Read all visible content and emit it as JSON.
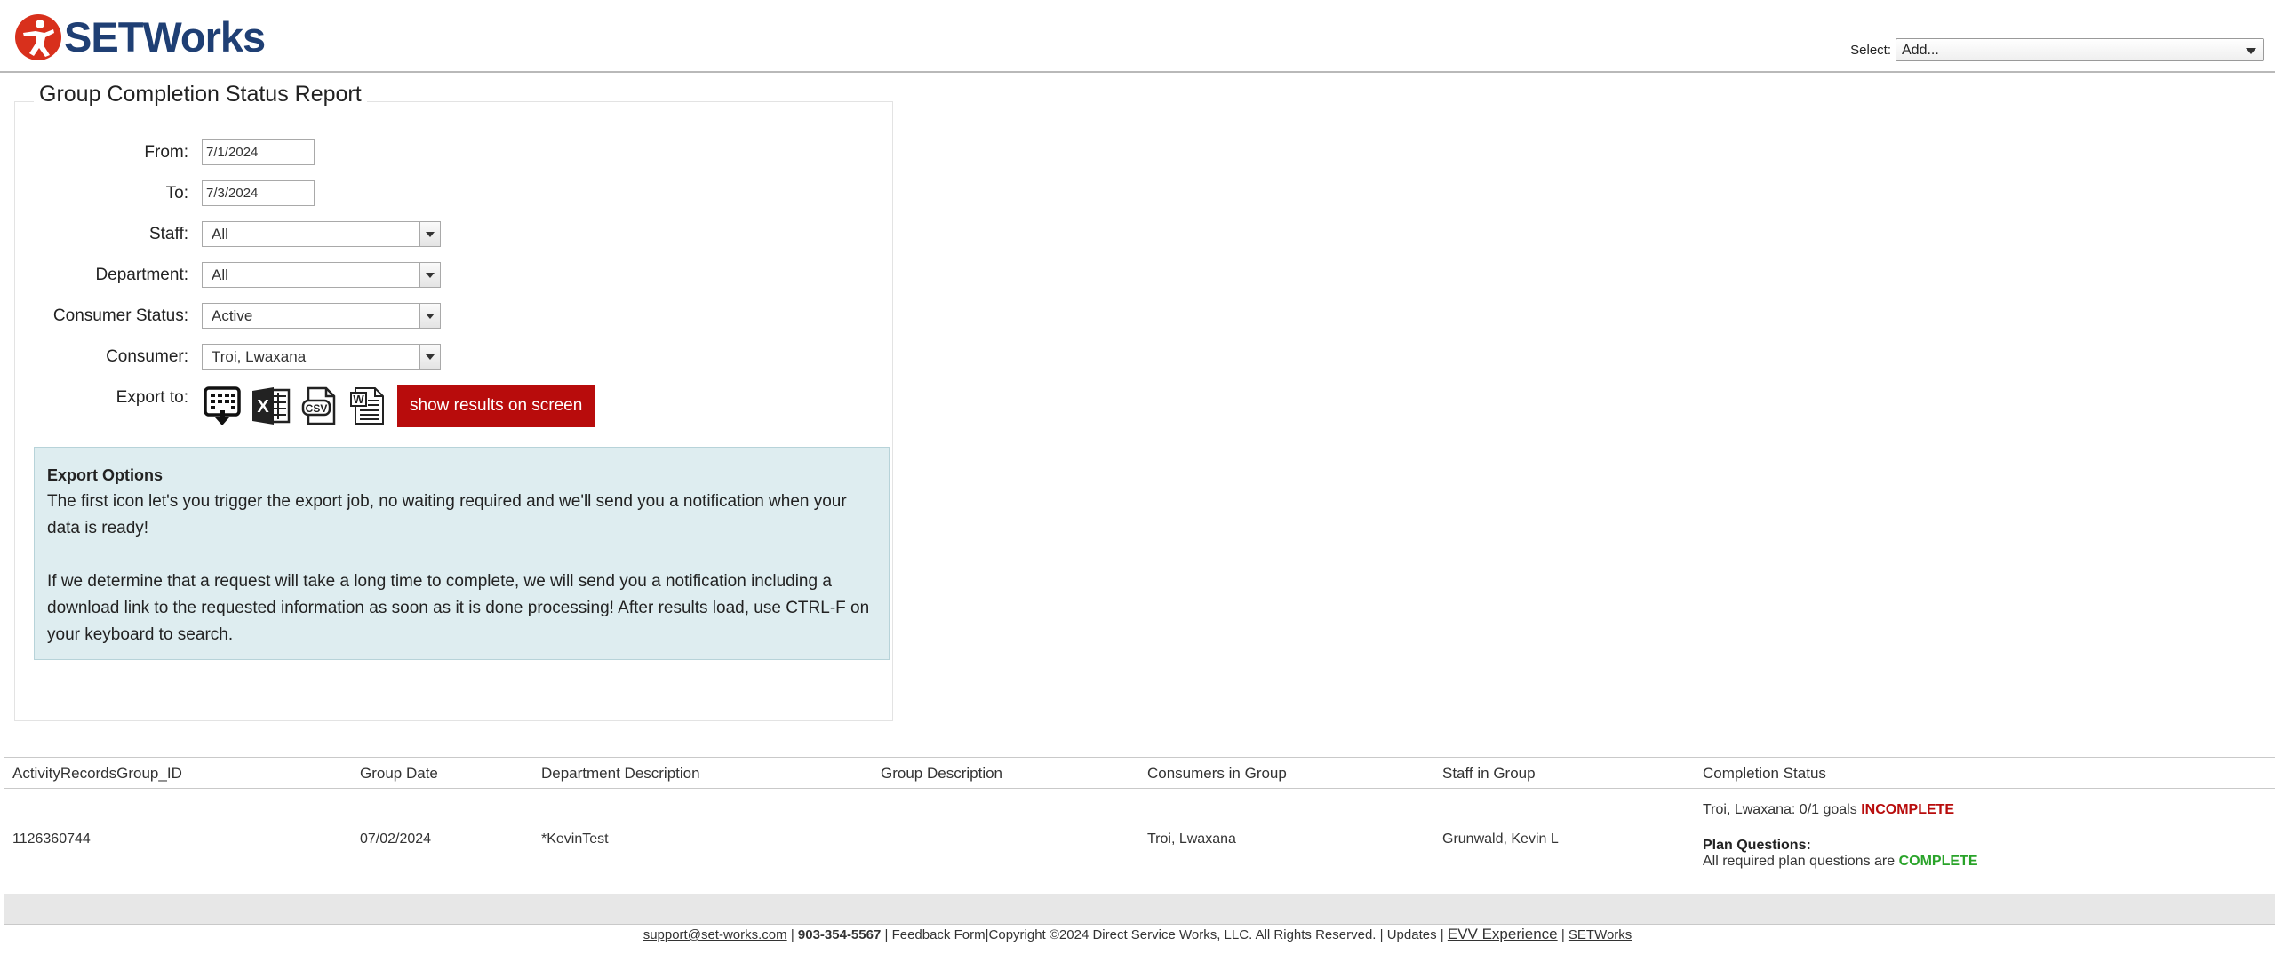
{
  "header": {
    "logo_text": "SETWorks",
    "select_label": "Select:",
    "select_value": "Add..."
  },
  "report": {
    "title": "Group Completion Status Report",
    "fields": {
      "from_label": "From:",
      "from_value": "7/1/2024",
      "to_label": "To:",
      "to_value": "7/3/2024",
      "staff_label": "Staff:",
      "staff_value": "All",
      "department_label": "Department:",
      "department_value": "All",
      "consumer_status_label": "Consumer Status:",
      "consumer_status_value": "Active",
      "consumer_label": "Consumer:",
      "consumer_value": "Troi, Lwaxana",
      "export_label": "Export to:"
    },
    "export_icons": [
      "background-export-icon",
      "excel-icon",
      "csv-icon",
      "word-icon"
    ],
    "show_results_label": "show results on screen",
    "info": {
      "heading": "Export Options",
      "para1": "The first icon let's you trigger the export job, no waiting required and we'll send you a notification when your data is ready!",
      "para2": "If we determine that a request will take a long time to complete, we will send you a notification including a download link to the requested information as soon as it is done processing! After results load, use CTRL-F on your keyboard to search."
    }
  },
  "table": {
    "headers": {
      "id": "ActivityRecordsGroup_ID",
      "date": "Group Date",
      "department": "Department Description",
      "group": "Group Description",
      "consumers": "Consumers in Group",
      "staff": "Staff in Group",
      "status": "Completion Status"
    },
    "rows": [
      {
        "id": "1126360744",
        "date": "07/02/2024",
        "department": "*KevinTest",
        "group": "",
        "consumers": "Troi, Lwaxana",
        "staff": "Grunwald, Kevin L",
        "status_prefix": "Troi, Lwaxana: 0/1 goals",
        "status_value": "INCOMPLETE",
        "plan_questions_label": "Plan Questions:",
        "plan_prefix": "All required plan questions are",
        "plan_value": "COMPLETE"
      }
    ]
  },
  "footer": {
    "email": "support@set-works.com",
    "phone": "903-354-5567",
    "feedback": "Feedback Form",
    "copyright": "Copyright ©2024 Direct Service Works, LLC. All Rights Reserved.",
    "updates": "Updates",
    "evv": "EVV Experience",
    "setworks": "SETWorks"
  },
  "colors": {
    "accent_red": "#b80c0c",
    "complete_green": "#29a329",
    "brand_blue": "#1f3f74",
    "info_bg": "#deedf0"
  }
}
